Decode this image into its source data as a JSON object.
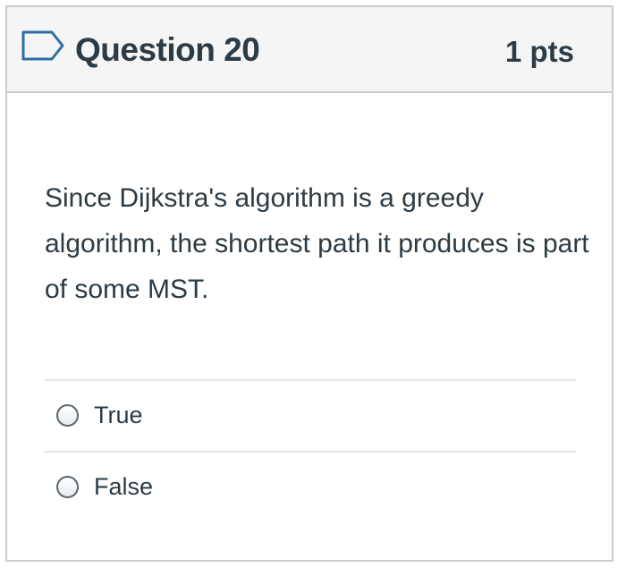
{
  "question": {
    "title": "Question 20",
    "points": "1 pts",
    "text": "Since Dijkstra's algorithm is a greedy algorithm, the shortest path it produces is part of some MST.",
    "flag_icon": "flag-outline-icon"
  },
  "answers": [
    {
      "label": "True",
      "selected": false
    },
    {
      "label": "False",
      "selected": false
    }
  ],
  "colors": {
    "text": "#2d3b45",
    "header_bg": "#f5f5f5",
    "border": "#c7cdd1",
    "flag": "#2b6ea8"
  }
}
